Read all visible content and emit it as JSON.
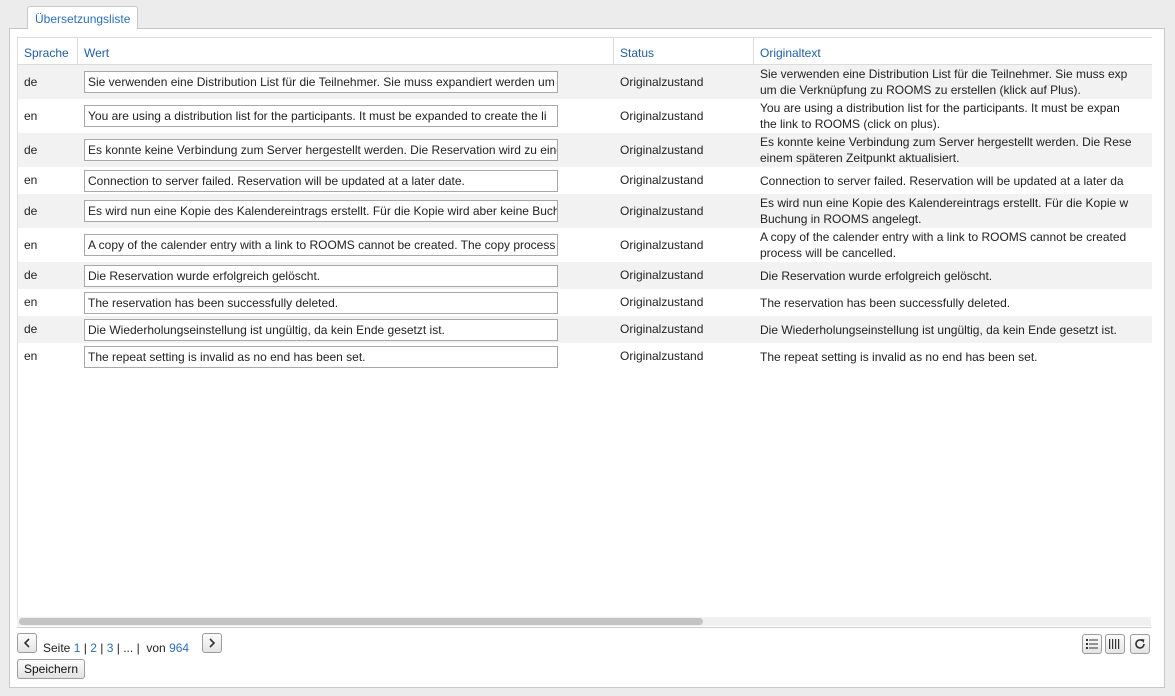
{
  "tab": {
    "label": "Übersetzungsliste"
  },
  "table": {
    "columns": {
      "language": "Sprache",
      "value": "Wert",
      "status": "Status",
      "original": "Originaltext"
    },
    "rows": [
      {
        "lang": "de",
        "value": "Sie verwenden eine Distribution List für die Teilnehmer. Sie muss expandiert werden um",
        "status": "Originalzustand",
        "orig1": "Sie verwenden eine Distribution List für die Teilnehmer. Sie muss exp",
        "orig2": "um die Verknüpfung zu ROOMS zu erstellen (klick auf Plus)."
      },
      {
        "lang": "en",
        "value": "You are using a distribution list for the participants. It must be expanded to create the li",
        "status": "Originalzustand",
        "orig1": "You are using a distribution list for the participants. It must be expan",
        "orig2": "the link to ROOMS (click on plus)."
      },
      {
        "lang": "de",
        "value": "Es konnte keine Verbindung zum Server hergestellt werden. Die Reservation wird zu eine",
        "status": "Originalzustand",
        "orig1": "Es konnte keine Verbindung zum Server hergestellt werden. Die Rese",
        "orig2": "einem späteren Zeitpunkt aktualisiert."
      },
      {
        "lang": "en",
        "value": "Connection to server failed. Reservation will be updated at a later date.",
        "status": "Originalzustand",
        "orig1": "Connection to server failed. Reservation will be updated at a later da",
        "orig2": ""
      },
      {
        "lang": "de",
        "value": "Es wird nun eine Kopie des Kalendereintrags erstellt. Für die Kopie wird aber keine Buchu",
        "status": "Originalzustand",
        "orig1": "Es wird nun eine Kopie des Kalendereintrags erstellt. Für die Kopie w",
        "orig2": "Buchung in ROOMS angelegt."
      },
      {
        "lang": "en",
        "value": "A copy of the calender entry with a link to ROOMS cannot be created. The copy process",
        "status": "Originalzustand",
        "orig1": "A copy of the calender entry with a link to ROOMS cannot be created",
        "orig2": "process will be cancelled."
      },
      {
        "lang": "de",
        "value": "Die Reservation wurde erfolgreich gelöscht.",
        "status": "Originalzustand",
        "orig1": "Die Reservation wurde erfolgreich gelöscht.",
        "orig2": ""
      },
      {
        "lang": "en",
        "value": "The reservation has been successfully deleted.",
        "status": "Originalzustand",
        "orig1": "The reservation has been successfully deleted.",
        "orig2": ""
      },
      {
        "lang": "de",
        "value": "Die Wiederholungseinstellung ist ungültig, da kein Ende gesetzt ist.",
        "status": "Originalzustand",
        "orig1": "Die Wiederholungseinstellung ist ungültig, da kein Ende gesetzt ist.",
        "orig2": ""
      },
      {
        "lang": "en",
        "value": "The repeat setting is invalid as no end has been set.",
        "status": "Originalzustand",
        "orig1": "The repeat setting is invalid as no end has been set.",
        "orig2": ""
      }
    ]
  },
  "pager": {
    "page_label": "Seite",
    "pages": [
      "1",
      "2",
      "3"
    ],
    "sep": "|",
    "ellipsis": "...",
    "of_label": "von",
    "total": "964",
    "prev_icon": "chevron-left-icon",
    "next_icon": "chevron-right-icon"
  },
  "toolbar": {
    "list_view_icon": "list-view-icon",
    "column_view_icon": "columns-icon",
    "refresh_icon": "refresh-icon"
  },
  "actions": {
    "save_label": "Speichern"
  }
}
